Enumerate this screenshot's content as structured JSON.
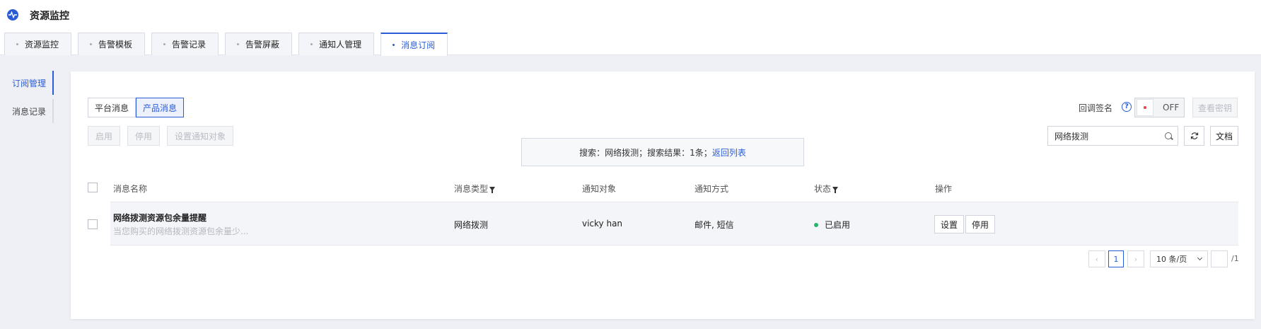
{
  "app": {
    "title": "资源监控",
    "logo_icon": "activity-icon"
  },
  "tabs": [
    {
      "label": "资源监控",
      "active": false
    },
    {
      "label": "告警模板",
      "active": false
    },
    {
      "label": "告警记录",
      "active": false
    },
    {
      "label": "告警屏蔽",
      "active": false
    },
    {
      "label": "通知人管理",
      "active": false
    },
    {
      "label": "消息订阅",
      "active": true
    }
  ],
  "sidebar": {
    "items": [
      {
        "label": "订阅管理",
        "active": true
      },
      {
        "label": "消息记录",
        "active": false
      }
    ]
  },
  "segment": {
    "platform_label": "平台消息",
    "product_label": "产品消息",
    "selected": "产品消息"
  },
  "toolbar": {
    "enable_label": "启用",
    "disable_label": "停用",
    "set_target_label": "设置通知对象",
    "callback_sign_label": "回调签名",
    "help_glyph": "?",
    "toggle_state": "OFF",
    "view_key_label": "查看密钥",
    "doc_label": "文档",
    "refresh_icon": "refresh-icon"
  },
  "search": {
    "value": "网络拨测",
    "placeholder": ""
  },
  "notice": {
    "text": "搜索：网络拨测；搜索结果：1条；",
    "link": "返回列表"
  },
  "table": {
    "columns": {
      "name": "消息名称",
      "type": "消息类型",
      "target": "通知对象",
      "method": "通知方式",
      "status": "状态",
      "ops": "操作"
    },
    "rows": [
      {
        "name": "网络拨测资源包余量提醒",
        "desc": "当您购买的网络拨测资源包余量少...",
        "type": "网络拨测",
        "target": "vicky han",
        "method": "邮件, 短信",
        "status": "已启用",
        "status_color": "#26b36a",
        "set_label": "设置",
        "disable_label": "停用"
      }
    ]
  },
  "pagination": {
    "current": "1",
    "page_size": "10 条/页",
    "total_pages": "/1",
    "jump_value": ""
  },
  "colors": {
    "accent": "#2a5cd6",
    "success": "#26b36a"
  }
}
